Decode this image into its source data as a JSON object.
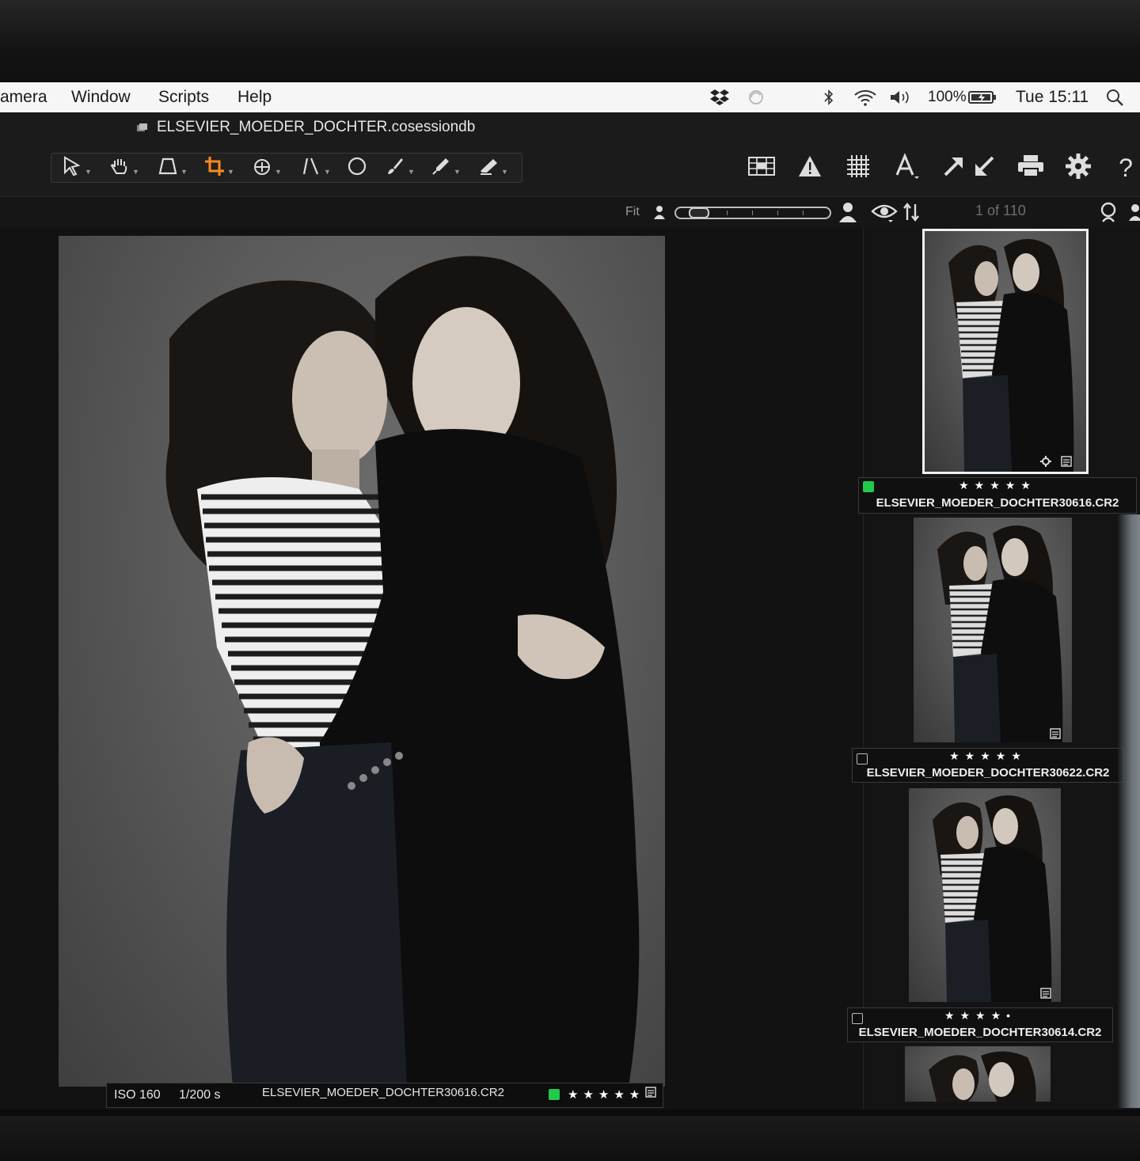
{
  "menu": {
    "items": [
      "amera",
      "Window",
      "Scripts",
      "Help"
    ],
    "battery": "100%",
    "clock": "Tue 15:11"
  },
  "session": {
    "title": "ELSEVIER_MOEDER_DOCHTER.cosessiondb"
  },
  "toolbar": {
    "left_tools": [
      "cursor-icon",
      "hand-icon",
      "keystone-icon",
      "crop-icon",
      "rotate-icon",
      "straighten-icon",
      "circle-icon",
      "brush-icon",
      "picker-icon",
      "eraser-icon"
    ],
    "active_tool": "crop-icon",
    "right_tools": [
      "grid-icon",
      "warning-icon",
      "overlay-grid-icon",
      "text-icon",
      "export-icon",
      "import-icon",
      "print-icon",
      "gear-icon",
      "help-icon"
    ],
    "help_label": "?"
  },
  "viewer_bar": {
    "fit_label": "Fit",
    "zoom_level": 0.05,
    "counter": "1 of 110"
  },
  "viewer": {
    "iso": "ISO 160",
    "shutter": "1/200 s",
    "filename": "ELSEVIER_MOEDER_DOCHTER30616.CR2",
    "stars": "★★★★★",
    "color_tag": "#22c94a"
  },
  "browser": {
    "items": [
      {
        "filename": "ELSEVIER_MOEDER_DOCHTER30616.CR2",
        "stars": "★★★★★",
        "tagged": true
      },
      {
        "filename": "ELSEVIER_MOEDER_DOCHTER30622.CR2",
        "stars": "★★★★★",
        "tagged": false
      },
      {
        "filename": "ELSEVIER_MOEDER_DOCHTER30614.CR2",
        "stars": "★★★★•",
        "tagged": false
      }
    ]
  },
  "colors": {
    "accent_crop": "#ff8a1f",
    "green_tag": "#22c94a"
  }
}
